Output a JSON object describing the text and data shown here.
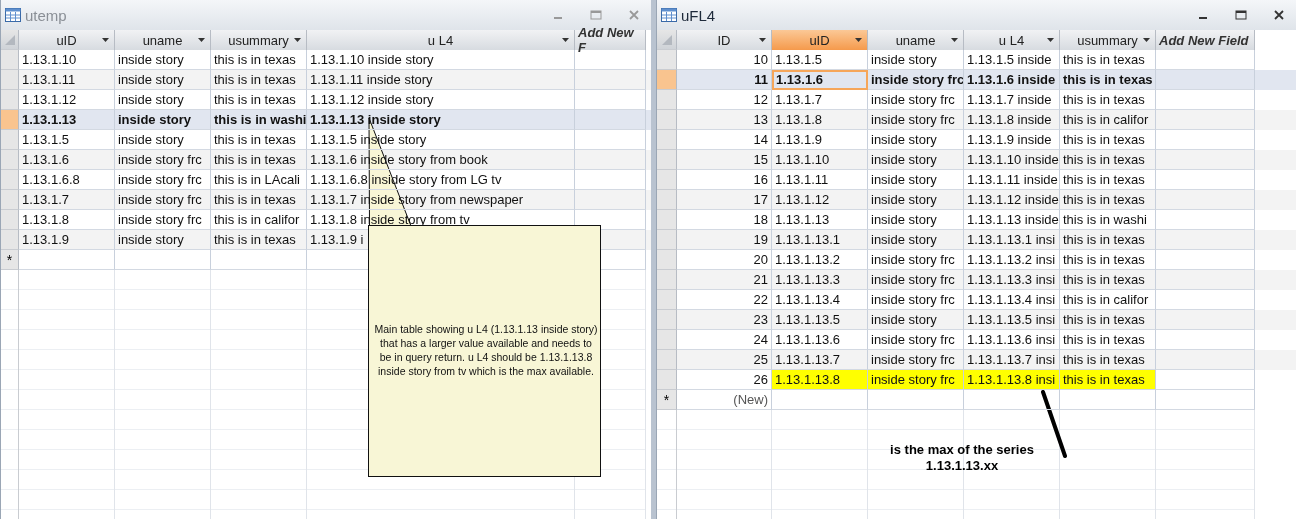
{
  "windows": [
    {
      "title": "utemp",
      "active": false,
      "columns": [
        {
          "label": "uID",
          "kind": "text",
          "selected": false
        },
        {
          "label": "uname",
          "kind": "text",
          "selected": false
        },
        {
          "label": "usummary",
          "kind": "text",
          "selected": false
        },
        {
          "label": "u L4",
          "kind": "text",
          "selected": false
        },
        {
          "label": "Add New F",
          "kind": "add",
          "selected": false
        }
      ],
      "rows": [
        {
          "cells": [
            "1.13.1.10",
            "inside story",
            "this is in texas",
            "1.13.1.10 inside story"
          ],
          "selected": false,
          "highlighted": false
        },
        {
          "cells": [
            "1.13.1.11",
            "inside story",
            "this is in texas",
            "1.13.1.11 inside story"
          ],
          "selected": false,
          "highlighted": false
        },
        {
          "cells": [
            "1.13.1.12",
            "inside story",
            "this is in texas",
            "1.13.1.12 inside story"
          ],
          "selected": false,
          "highlighted": false
        },
        {
          "cells": [
            "1.13.1.13",
            "inside story",
            "this is in washi",
            "1.13.1.13 inside story"
          ],
          "selected": true,
          "highlighted": false
        },
        {
          "cells": [
            "1.13.1.5",
            "inside story",
            "this is in texas",
            "1.13.1.5 inside story"
          ],
          "selected": false,
          "highlighted": false
        },
        {
          "cells": [
            "1.13.1.6",
            "inside story frc",
            "this is in texas",
            "1.13.1.6 inside story from book"
          ],
          "selected": false,
          "highlighted": false
        },
        {
          "cells": [
            "1.13.1.6.8",
            "inside story frc",
            "this is in LAcali",
            "1.13.1.6.8 inside story from LG tv"
          ],
          "selected": false,
          "highlighted": false
        },
        {
          "cells": [
            "1.13.1.7",
            "inside story frc",
            "this is in texas",
            "1.13.1.7 inside story from newspaper"
          ],
          "selected": false,
          "highlighted": false
        },
        {
          "cells": [
            "1.13.1.8",
            "inside story frc",
            "this is in califor",
            "1.13.1.8 inside story from tv"
          ],
          "selected": false,
          "highlighted": false
        },
        {
          "cells": [
            "1.13.1.9",
            "inside story",
            "this is in texas",
            "1.13.1.9 i"
          ],
          "selected": false,
          "highlighted": false
        }
      ],
      "new_row": {
        "marker": "*"
      }
    },
    {
      "title": "uFL4",
      "active": true,
      "columns": [
        {
          "label": "ID",
          "kind": "number",
          "selected": false
        },
        {
          "label": "uID",
          "kind": "text",
          "selected": true
        },
        {
          "label": "uname",
          "kind": "text",
          "selected": false
        },
        {
          "label": "u L4",
          "kind": "text",
          "selected": false
        },
        {
          "label": "usummary",
          "kind": "text",
          "selected": false
        },
        {
          "label": "Add New Field",
          "kind": "add",
          "selected": false
        }
      ],
      "rows": [
        {
          "cells": [
            "10",
            "1.13.1.5",
            "inside story",
            "1.13.1.5 inside",
            "this is in texas"
          ],
          "selected": false,
          "highlighted": false
        },
        {
          "cells": [
            "11",
            "1.13.1.6",
            "inside story frc",
            "1.13.1.6 inside",
            "this is in texas"
          ],
          "selected": true,
          "highlighted": false
        },
        {
          "cells": [
            "12",
            "1.13.1.7",
            "inside story frc",
            "1.13.1.7 inside",
            "this is in texas"
          ],
          "selected": false,
          "highlighted": false
        },
        {
          "cells": [
            "13",
            "1.13.1.8",
            "inside story frc",
            "1.13.1.8 inside",
            "this is in califor"
          ],
          "selected": false,
          "highlighted": false
        },
        {
          "cells": [
            "14",
            "1.13.1.9",
            "inside story",
            "1.13.1.9 inside",
            "this is in texas"
          ],
          "selected": false,
          "highlighted": false
        },
        {
          "cells": [
            "15",
            "1.13.1.10",
            "inside story",
            "1.13.1.10 inside",
            "this is in texas"
          ],
          "selected": false,
          "highlighted": false
        },
        {
          "cells": [
            "16",
            "1.13.1.11",
            "inside story",
            "1.13.1.11 inside",
            "this is in texas"
          ],
          "selected": false,
          "highlighted": false
        },
        {
          "cells": [
            "17",
            "1.13.1.12",
            "inside story",
            "1.13.1.12 inside",
            "this is in texas"
          ],
          "selected": false,
          "highlighted": false
        },
        {
          "cells": [
            "18",
            "1.13.1.13",
            "inside story",
            "1.13.1.13 inside",
            "this is in washi"
          ],
          "selected": false,
          "highlighted": false
        },
        {
          "cells": [
            "19",
            "1.13.1.13.1",
            "inside story",
            "1.13.1.13.1 insi",
            "this is in texas"
          ],
          "selected": false,
          "highlighted": false
        },
        {
          "cells": [
            "20",
            "1.13.1.13.2",
            "inside story frc",
            "1.13.1.13.2 insi",
            "this is in texas"
          ],
          "selected": false,
          "highlighted": false
        },
        {
          "cells": [
            "21",
            "1.13.1.13.3",
            "inside story frc",
            "1.13.1.13.3 insi",
            "this is in texas"
          ],
          "selected": false,
          "highlighted": false
        },
        {
          "cells": [
            "22",
            "1.13.1.13.4",
            "inside story frc",
            "1.13.1.13.4 insi",
            "this is in califor"
          ],
          "selected": false,
          "highlighted": false
        },
        {
          "cells": [
            "23",
            "1.13.1.13.5",
            "inside story",
            "1.13.1.13.5 insi",
            "this is in texas"
          ],
          "selected": false,
          "highlighted": false
        },
        {
          "cells": [
            "24",
            "1.13.1.13.6",
            "inside story frc",
            "1.13.1.13.6 insi",
            "this is in texas"
          ],
          "selected": false,
          "highlighted": false
        },
        {
          "cells": [
            "25",
            "1.13.1.13.7",
            "inside story frc",
            "1.13.1.13.7 insi",
            "this is in texas"
          ],
          "selected": false,
          "highlighted": false
        },
        {
          "cells": [
            "26",
            "1.13.1.13.8",
            "inside story frc",
            "1.13.1.13.8 insi",
            "this is in texas"
          ],
          "selected": false,
          "highlighted": true
        }
      ],
      "new_row": {
        "marker": "*",
        "cells": [
          "(New)"
        ]
      }
    }
  ],
  "callout": {
    "text": "Main table showing u L4 (1.13.1.13 inside story) that has a larger value available and needs to be in query return.  u L4 should be 1.13.1.13.8 inside story from tv which is the max available."
  },
  "annotation": {
    "lines": [
      "is the max of the series",
      "1.13.1.13.xx"
    ]
  }
}
